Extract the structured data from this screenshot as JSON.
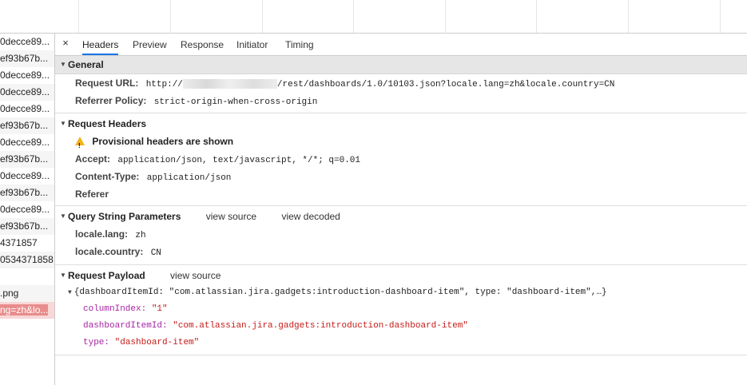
{
  "request_list": [
    {
      "label": "0decce89..."
    },
    {
      "label": "ef93b67b..."
    },
    {
      "label": "0decce89..."
    },
    {
      "label": "0decce89..."
    },
    {
      "label": "0decce89..."
    },
    {
      "label": "ef93b67b..."
    },
    {
      "label": "0decce89..."
    },
    {
      "label": "ef93b67b..."
    },
    {
      "label": "0decce89..."
    },
    {
      "label": "ef93b67b..."
    },
    {
      "label": "0decce89..."
    },
    {
      "label": "ef93b67b..."
    },
    {
      "label": "4371857"
    },
    {
      "label": "0534371858"
    },
    {
      "label": ""
    },
    {
      "label": ".png"
    },
    {
      "label": "ng=zh&lo..."
    }
  ],
  "tabs": {
    "close": "×",
    "headers": "Headers",
    "preview": "Preview",
    "response": "Response",
    "initiator": "Initiator",
    "timing": "Timing"
  },
  "general": {
    "title": "General",
    "request_url_label": "Request URL:",
    "request_url_prefix": "http://",
    "request_url_suffix": "/rest/dashboards/1.0/10103.json?locale.lang=zh&locale.country=CN",
    "referrer_policy_label": "Referrer Policy:",
    "referrer_policy_value": "strict-origin-when-cross-origin"
  },
  "request_headers": {
    "title": "Request Headers",
    "warning": "Provisional headers are shown",
    "accept_label": "Accept:",
    "accept_value": "application/json, text/javascript, */*; q=0.01",
    "content_type_label": "Content-Type:",
    "content_type_value": "application/json",
    "referer_label": "Referer"
  },
  "query_params": {
    "title": "Query String Parameters",
    "view_source": "view source",
    "view_decoded": "view decoded",
    "lang_label": "locale.lang:",
    "lang_value": "zh",
    "country_label": "locale.country:",
    "country_value": "CN"
  },
  "payload": {
    "title": "Request Payload",
    "view_source": "view source",
    "summary": "{dashboardItemId: \"com.atlassian.jira.gadgets:introduction-dashboard-item\", type: \"dashboard-item\",…}",
    "column_index_label": "columnIndex:",
    "column_index_value": "\"1\"",
    "item_id_label": "dashboardItemId:",
    "item_id_value": "\"com.atlassian.jira.gadgets:introduction-dashboard-item\"",
    "type_label": "type:",
    "type_value": "\"dashboard-item\""
  }
}
